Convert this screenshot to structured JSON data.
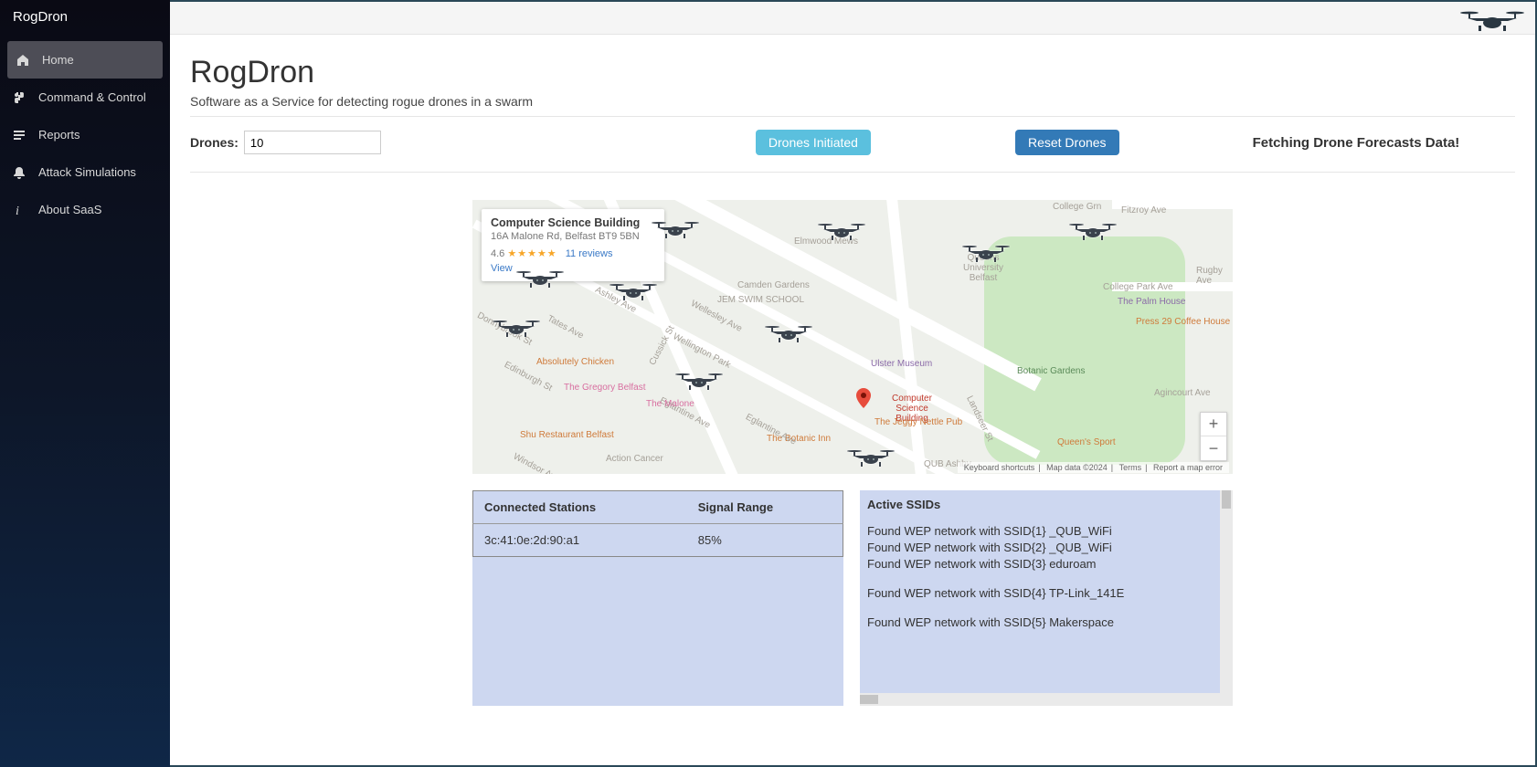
{
  "brand": "RogDron",
  "sidebar": {
    "items": [
      {
        "label": "Home",
        "icon": "home",
        "active": true
      },
      {
        "label": "Command & Control",
        "icon": "command",
        "active": false
      },
      {
        "label": "Reports",
        "icon": "reports",
        "active": false
      },
      {
        "label": "Attack Simulations",
        "icon": "bell",
        "active": false
      },
      {
        "label": "About SaaS",
        "icon": "info",
        "active": false
      }
    ]
  },
  "header": {
    "title": "RogDron",
    "subtitle": "Software as a Service for detecting rogue drones in a swarm"
  },
  "controls": {
    "drones_label": "Drones:",
    "drones_value": "10",
    "initiate_label": "Drones Initiated",
    "reset_label": "Reset Drones",
    "status": "Fetching Drone Forecasts Data!"
  },
  "map": {
    "poi": {
      "title": "Computer Science Building",
      "address": "16A Malone Rd, Belfast BT9 5BN",
      "rating": "4.6",
      "reviews": "11 reviews",
      "view": "View"
    },
    "labels": {
      "l1": "College Grn",
      "l2": "Fitzroy Ave",
      "l3": "Rugby Ave",
      "l4": "College Park Ave",
      "l5": "The Palm House",
      "l6": "Press 29 Coffee House",
      "l7": "Botanic Gardens",
      "l8": "Agincourt Ave",
      "l9": "Queen's Sport",
      "l10": "QUB Ashby",
      "l11": "Queens University Belfast",
      "l12": "Ulster Museum",
      "l13": "JEM SWIM SCHOOL",
      "l14": "Camden Gardens",
      "l15": "Elmwood Mews",
      "l16": "Wellesley Ave",
      "l17": "Wellington Park",
      "l18": "Eglantine Ave",
      "l19": "Computer Science Building",
      "l20": "The Jeggy Nettle Pub",
      "l21": "Landseer St",
      "l22": "The Botanic Inn",
      "l23": "Action Cancer",
      "l24": "Windsor Ave",
      "l25": "Ashley Ave",
      "l26": "Tates Ave",
      "l27": "Donnybrook St",
      "l28": "Edinburgh St",
      "l29": "Cussick St",
      "l30": "Absolutely Chicken",
      "l31": "The Gregory Belfast",
      "l32": "The Malone",
      "l33": "Shu Restaurant Belfast",
      "l34": "Eglantine Ave"
    },
    "attribution": {
      "a": "Keyboard shortcuts",
      "b": "Map data ©2024",
      "c": "Terms",
      "d": "Report a map error"
    }
  },
  "stations": {
    "col1": "Connected Stations",
    "col2": "Signal Range",
    "rows": [
      {
        "mac": "3c:41:0e:2d:90:a1",
        "signal": "85%"
      }
    ]
  },
  "ssids": {
    "title": "Active SSIDs",
    "lines": [
      "Found WEP network with SSID{1} _QUB_WiFi",
      "Found WEP network with SSID{2} _QUB_WiFi",
      "Found WEP network with SSID{3} eduroam",
      "",
      "Found WEP network with SSID{4} TP-Link_141E",
      "",
      "Found WEP network with SSID{5} Makerspace"
    ]
  }
}
